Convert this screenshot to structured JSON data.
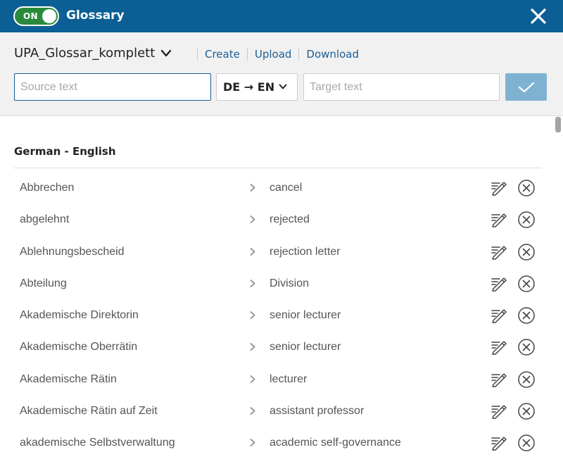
{
  "header": {
    "toggle_label": "ON",
    "toggle_state": "on",
    "title": "Glossary",
    "close_icon": "close-icon"
  },
  "toolbar": {
    "glossary_name": "UPA_Glossar_komplett",
    "links": [
      "Create",
      "Upload",
      "Download"
    ]
  },
  "form": {
    "source_placeholder": "Source text",
    "source_value": "",
    "language_pair": "DE → EN",
    "target_placeholder": "Target text",
    "target_value": ""
  },
  "list": {
    "heading": "German - English",
    "entries": [
      {
        "source": "Abbrechen",
        "target": "cancel"
      },
      {
        "source": "abgelehnt",
        "target": "rejected"
      },
      {
        "source": "Ablehnungsbescheid",
        "target": "rejection letter"
      },
      {
        "source": "Abteilung",
        "target": "Division"
      },
      {
        "source": "Akademische Direktorin",
        "target": "senior lecturer"
      },
      {
        "source": "Akademische Oberrätin",
        "target": "senior lecturer"
      },
      {
        "source": "Akademische Rätin",
        "target": "lecturer"
      },
      {
        "source": "Akademische Rätin auf Zeit",
        "target": "assistant professor"
      },
      {
        "source": "akademische Selbstverwaltung",
        "target": "academic self-governance"
      }
    ]
  },
  "colors": {
    "header_bg": "#0c5f94",
    "toggle_on": "#2a8a3c",
    "link": "#1a5e96",
    "confirm_button": "#7fb2d1",
    "panel_bg": "#f1f1f1"
  }
}
